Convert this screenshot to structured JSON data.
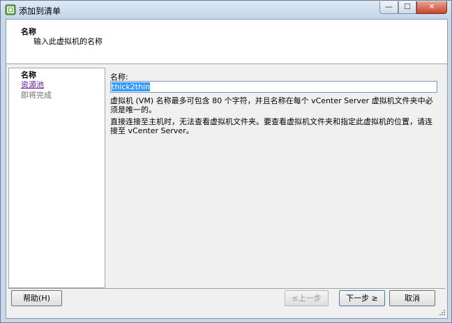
{
  "window": {
    "title": "添加到清单",
    "minimize_glyph": "—",
    "maximize_glyph": "☐",
    "close_glyph": "✕",
    "icon": "vsphere-app-icon"
  },
  "header": {
    "title": "名称",
    "subtitle": "输入此虚拟机的名称"
  },
  "steps": [
    {
      "label": "名称",
      "state": "current"
    },
    {
      "label": "资源池",
      "state": "link"
    },
    {
      "label": "即将完成",
      "state": "disabled"
    }
  ],
  "form": {
    "name_label": "名称:",
    "name_value": "thick2thin",
    "description_1": "虚拟机 (VM) 名称最多可包含 80 个字符，并且名称在每个 vCenter Server 虚拟机文件夹中必须是唯一的。",
    "description_2": "直接连接至主机时，无法查看虚拟机文件夹。要查看虚拟机文件夹和指定此虚拟机的位置，请连接至 vCenter Server。"
  },
  "buttons": {
    "help": "帮助(H)",
    "back": "≤上一步",
    "next": "下一步 ≥",
    "cancel": "取消"
  },
  "colors": {
    "selection": "#3399ff",
    "link": "#6a1c9a",
    "close_button": "#c9462c"
  }
}
